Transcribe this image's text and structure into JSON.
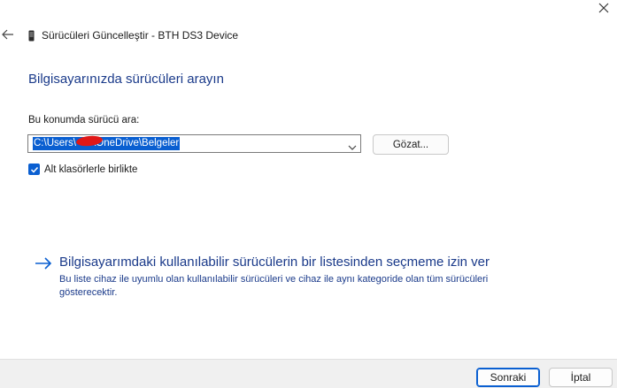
{
  "window": {
    "title": "Sürücüleri Güncelleştir - BTH DS3 Device",
    "close_glyph": "✕"
  },
  "page": {
    "heading": "Bilgisayarınızda sürücüleri arayın",
    "search_label": "Bu konumda sürücü ara:",
    "path_value": "C:\\Users\\      \\OneDrive\\Belgeler",
    "browse_button": "Gözat...",
    "include_subfolders_label": "Alt klasörlerle birlikte",
    "include_subfolders_checked": true
  },
  "pick_link": {
    "title": "Bilgisayarımdaki kullanılabilir sürücülerin bir listesinden seçmeme izin ver",
    "description": "Bu liste cihaz ile uyumlu olan kullanılabilir sürücüleri ve cihaz ile aynı kategoride olan tüm sürücüleri gösterecektir."
  },
  "footer": {
    "next_button": "Sonraki",
    "cancel_button": "İptal"
  },
  "icons": {
    "back": "back-arrow-icon",
    "device": "device-icon",
    "chevron": "chevron-down-icon",
    "check": "checkmark-icon",
    "link_arrow": "right-arrow-icon",
    "close": "close-icon"
  },
  "colors": {
    "accent": "#0a5fd1",
    "heading": "#1a3a8a",
    "redaction": "#e01818"
  }
}
